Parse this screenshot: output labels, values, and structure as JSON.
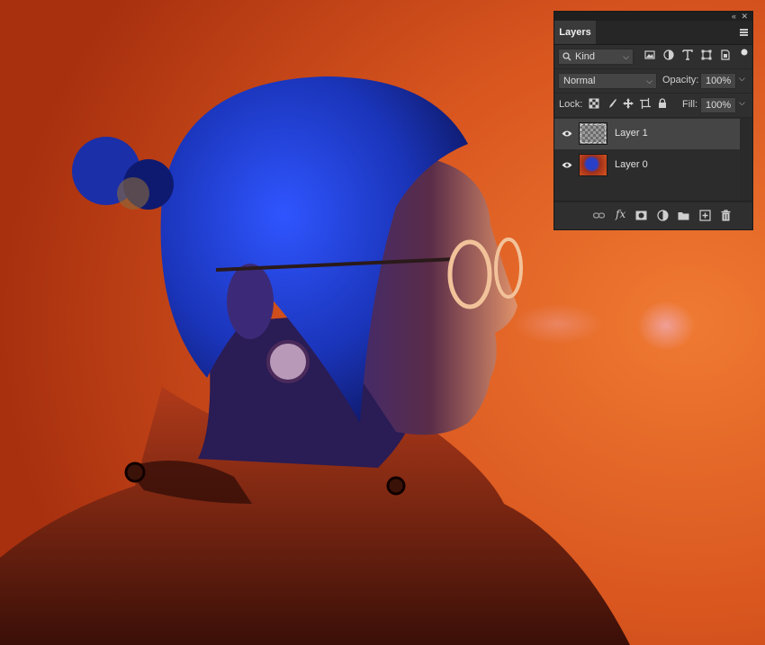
{
  "panel": {
    "collapse_icon": "«",
    "close_icon": "✕",
    "tab_label": "Layers",
    "filter": {
      "label": "Kind",
      "icon": "search-icon"
    },
    "blend_mode": "Normal",
    "opacity_label": "Opacity:",
    "opacity_value": "100%",
    "lock_label": "Lock:",
    "fill_label": "Fill:",
    "fill_value": "100%"
  },
  "layers": [
    {
      "name": "Layer 1",
      "selected": true,
      "visible": true,
      "thumb": "transparent"
    },
    {
      "name": "Layer 0",
      "selected": false,
      "visible": true,
      "thumb": "photo"
    }
  ],
  "colors": {
    "panel_bg": "#2f2f2f",
    "selected_row": "#454545",
    "background_orange": "#c8461c",
    "hair_blue": "#1f3fd0"
  }
}
